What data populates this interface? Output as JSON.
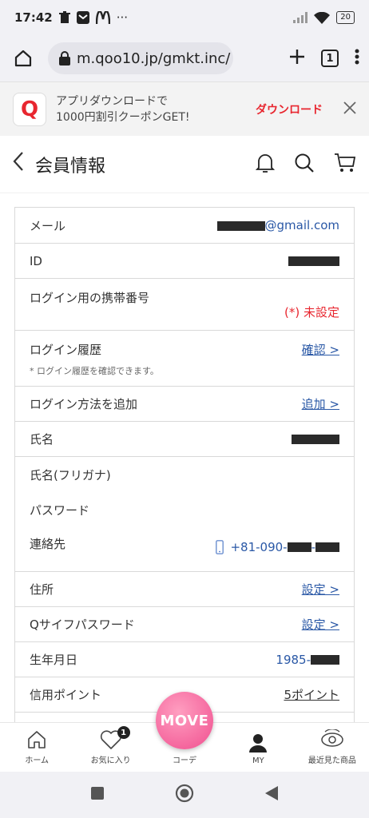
{
  "status_bar": {
    "time": "17:42",
    "dots": "···",
    "battery": "20"
  },
  "browser": {
    "url": "m.qoo10.jp/gmkt.inc/",
    "tab_count": "1"
  },
  "banner": {
    "line1": "アプリダウンロードで",
    "line2": "1000円割引クーポンGET!",
    "download_label": "ダウンロード",
    "logo_letter": "Q"
  },
  "header": {
    "title": "会員情報"
  },
  "rows": {
    "email": {
      "label": "メール",
      "value": "@gmail.com"
    },
    "id": {
      "label": "ID"
    },
    "login_phone": {
      "label": "ログイン用の携帯番号",
      "value": "(*) 未設定"
    },
    "login_history": {
      "label": "ログイン履歴",
      "link": "確認 >",
      "note": "* ログイン履歴を確認できます。"
    },
    "add_login": {
      "label": "ログイン方法を追加",
      "link": "追加 >"
    },
    "name": {
      "label": "氏名"
    },
    "name_kana": {
      "label": "氏名(フリガナ)"
    },
    "password": {
      "label": "パスワード"
    },
    "contact": {
      "label": "連絡先",
      "value_prefix": "+81-090-",
      "value_sep": "-"
    },
    "address": {
      "label": "住所",
      "link": "設定 >"
    },
    "q_wallet": {
      "label": "Qサイフパスワード",
      "link": "設定 >"
    },
    "birthday": {
      "label": "生年月日",
      "value_prefix": "1985-"
    },
    "credit": {
      "label": "信用ポイント",
      "link": "5ポイント"
    }
  },
  "bottom_nav": {
    "home": "ホーム",
    "favorites": "お気に入り",
    "favorites_badge": "1",
    "coordinate": "コーデ",
    "move": "MOVE",
    "my": "MY",
    "recent": "最近見た商品"
  },
  "colors": {
    "accent_red": "#e8262f",
    "link_blue": "#2a58a6",
    "move_pink": "#f04f8f"
  }
}
